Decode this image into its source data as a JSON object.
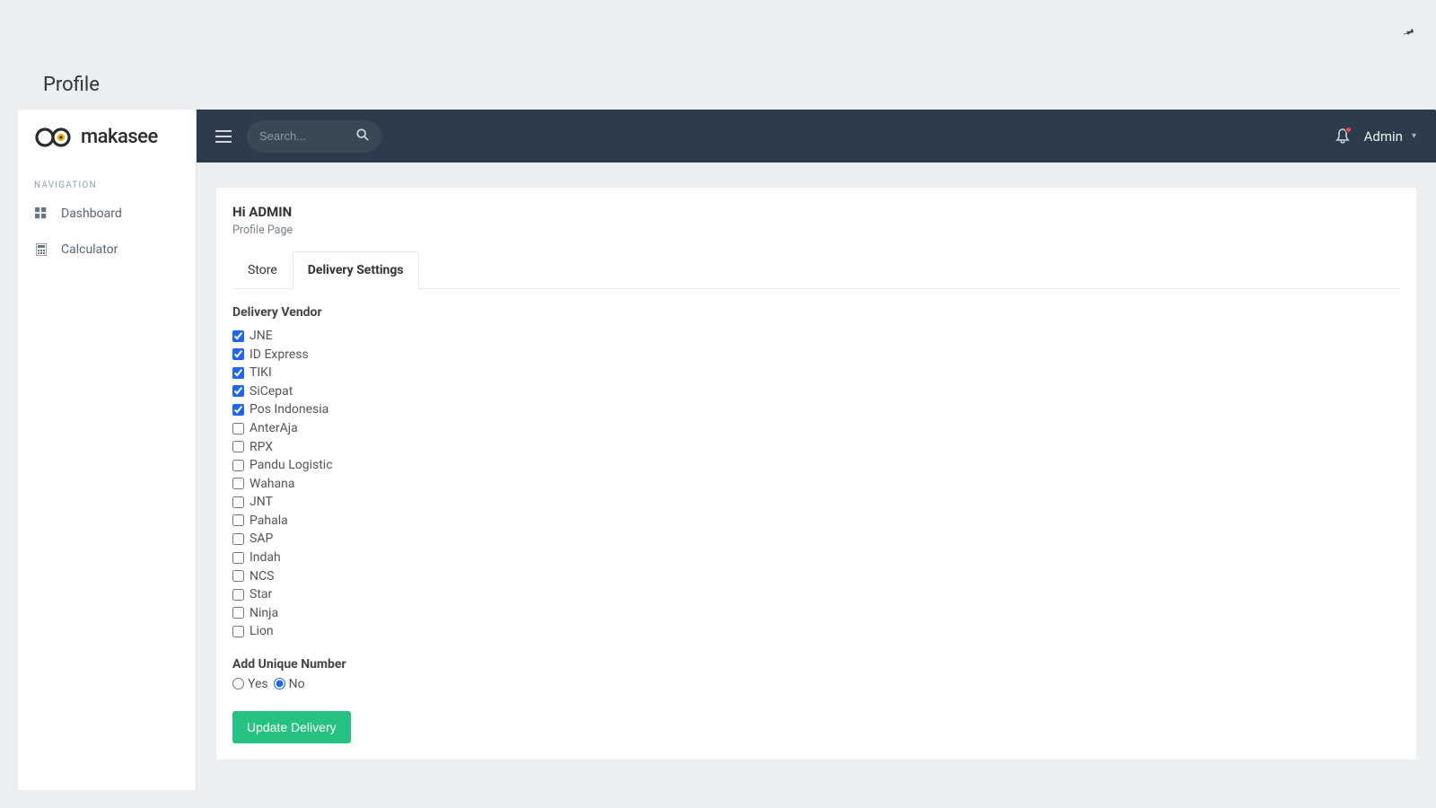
{
  "outer": {
    "title": "Profile"
  },
  "brand": {
    "name": "makasee"
  },
  "sidebar": {
    "heading": "NAVIGATION",
    "items": [
      {
        "label": "Dashboard"
      },
      {
        "label": "Calculator"
      }
    ]
  },
  "topbar": {
    "search_placeholder": "Search...",
    "user_name": "Admin"
  },
  "card": {
    "title": "Hi  ADMIN",
    "subtitle": "Profile Page",
    "tabs": [
      {
        "label": "Store",
        "active": false
      },
      {
        "label": "Delivery Settings",
        "active": true
      }
    ],
    "vendor_section_label": "Delivery Vendor",
    "vendors": [
      {
        "label": "JNE",
        "checked": true
      },
      {
        "label": "ID Express",
        "checked": true
      },
      {
        "label": "TIKI",
        "checked": true
      },
      {
        "label": "SiCepat",
        "checked": true
      },
      {
        "label": "Pos Indonesia",
        "checked": true
      },
      {
        "label": "AnterAja",
        "checked": false
      },
      {
        "label": "RPX",
        "checked": false
      },
      {
        "label": "Pandu Logistic",
        "checked": false
      },
      {
        "label": "Wahana",
        "checked": false
      },
      {
        "label": "JNT",
        "checked": false
      },
      {
        "label": "Pahala",
        "checked": false
      },
      {
        "label": "SAP",
        "checked": false
      },
      {
        "label": "Indah",
        "checked": false
      },
      {
        "label": "NCS",
        "checked": false
      },
      {
        "label": "Star",
        "checked": false
      },
      {
        "label": "Ninja",
        "checked": false
      },
      {
        "label": "Lion",
        "checked": false
      }
    ],
    "unique_number_label": "Add Unique Number",
    "unique_options": {
      "yes": "Yes",
      "no": "No",
      "selected": "no"
    },
    "update_button": "Update Delivery"
  }
}
